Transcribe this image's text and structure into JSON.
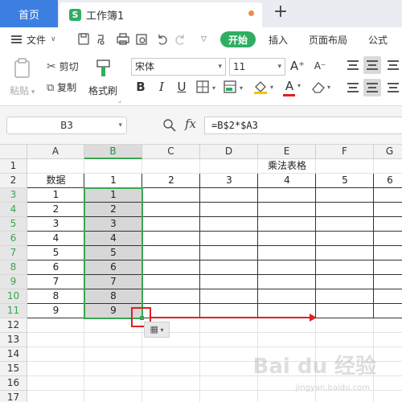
{
  "tabs": {
    "home": "首页",
    "doc_logo": "S",
    "doc_title": "工作簿1",
    "new_tab": "+"
  },
  "menu": {
    "file": "文件",
    "start": "开始",
    "insert": "插入",
    "page_layout": "页面布局",
    "formula": "公式"
  },
  "ribbon": {
    "paste": "粘贴",
    "cut": "剪切",
    "copy": "复制",
    "format_painter": "格式刷",
    "font_name": "宋体",
    "font_size": "11",
    "bold": "B",
    "italic": "I",
    "underline": "U",
    "font_color": "A",
    "increase_font": "A⁺",
    "decrease_font": "A⁻"
  },
  "formula_bar": {
    "name_box": "B3",
    "fx": "fx",
    "formula": "=B$2*$A3"
  },
  "grid": {
    "columns": [
      "A",
      "B",
      "C",
      "D",
      "E",
      "F",
      "G"
    ],
    "rows": [
      "1",
      "2",
      "3",
      "4",
      "5",
      "6",
      "7",
      "8",
      "9",
      "10",
      "11",
      "12",
      "13",
      "14",
      "15",
      "16",
      "17"
    ],
    "title": "乘法表格",
    "header_row": [
      "数据",
      "1",
      "2",
      "3",
      "4",
      "5",
      "6"
    ],
    "col_a": [
      "1",
      "2",
      "3",
      "4",
      "5",
      "6",
      "7",
      "8",
      "9"
    ],
    "col_b": [
      "1",
      "2",
      "3",
      "4",
      "5",
      "6",
      "7",
      "8",
      "9"
    ]
  },
  "watermark": {
    "main": "Bai du 经验",
    "sub": "jingyan.baidu.com"
  },
  "colors": {
    "accent_green": "#2fae61",
    "tab_blue": "#3d7fe0",
    "selection_green": "#3aa54e",
    "annotation_red": "#e02020"
  }
}
